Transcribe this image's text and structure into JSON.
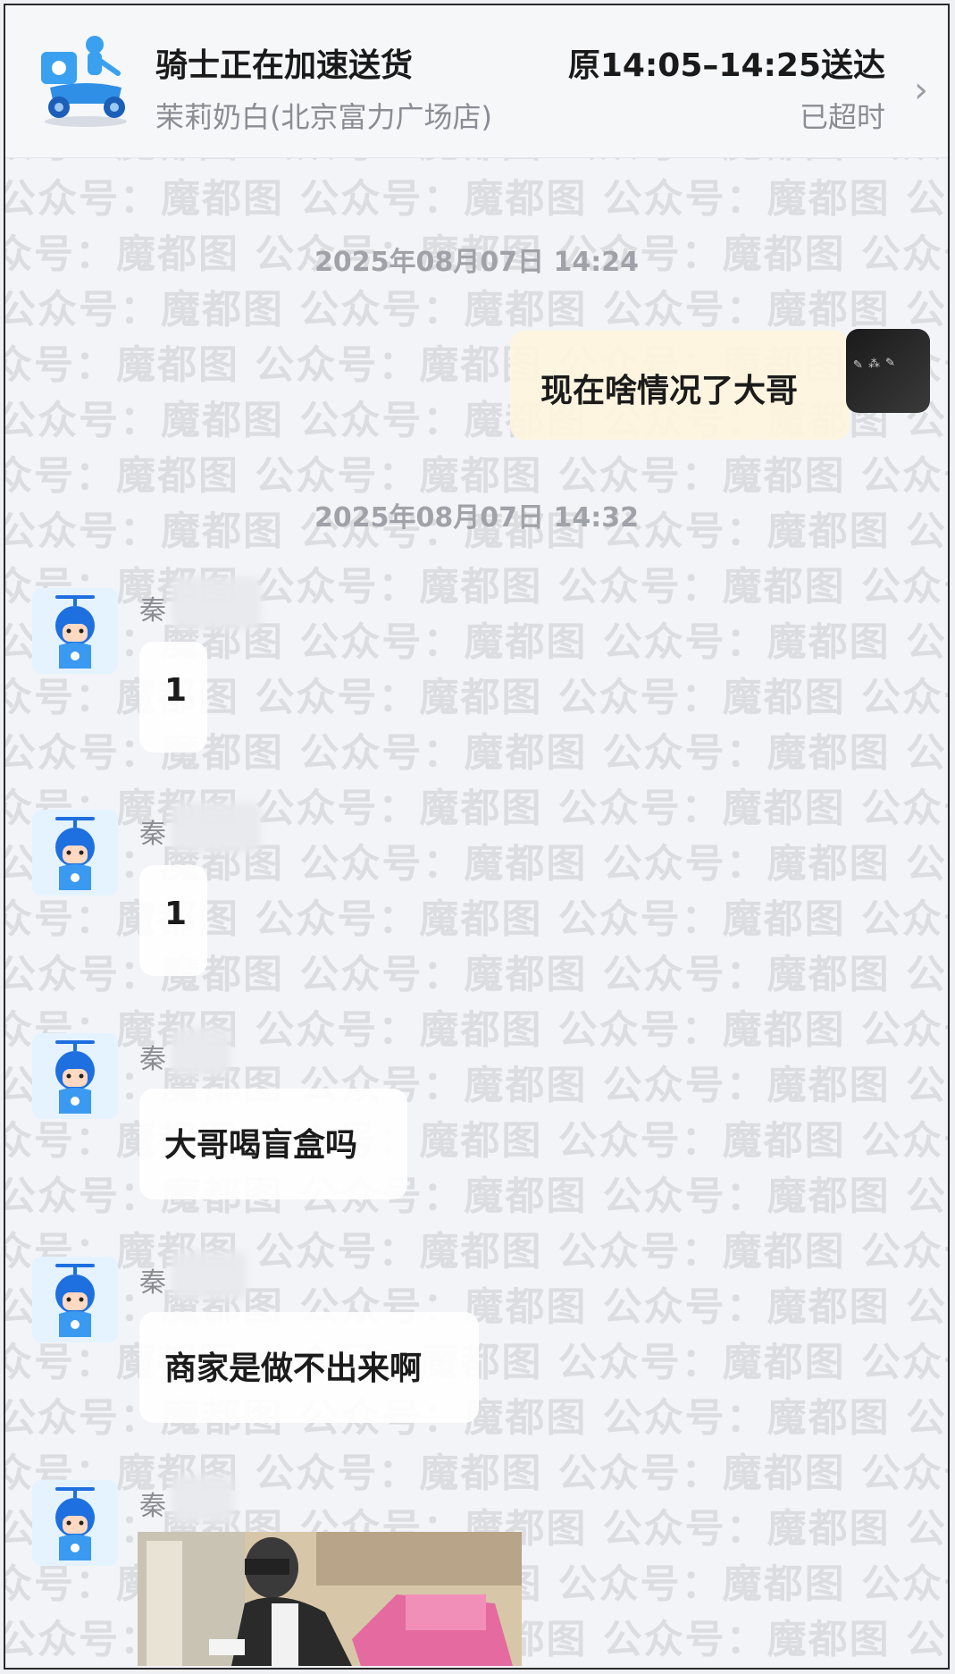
{
  "header": {
    "status_title": "骑士正在加速送货",
    "store_name": "茉莉奶白(北京富力广场店)",
    "eta": "原14:05–14:25送达",
    "overtime": "已超时"
  },
  "watermark": {
    "text": "公众号：魔都图"
  },
  "messages": [
    {
      "type": "timestamp",
      "text": "2025年08月07日 14:24"
    },
    {
      "type": "me",
      "text": "现在啥情况了大哥"
    },
    {
      "type": "timestamp",
      "text": "2025年08月07日 14:32"
    },
    {
      "type": "other",
      "sender": "秦",
      "text": "1"
    },
    {
      "type": "other",
      "sender": "秦",
      "text": "1"
    },
    {
      "type": "other",
      "sender": "秦",
      "text": "大哥喝盲盒吗"
    },
    {
      "type": "other",
      "sender": "秦",
      "text": "商家是做不出来啊"
    },
    {
      "type": "other",
      "sender": "秦",
      "text": ""
    }
  ],
  "colors": {
    "background": "#f3f4f7",
    "my_bubble": "#fff5de",
    "other_bubble": "#ffffff",
    "mascot_blue": "#1e6fe0",
    "timestamp_gray": "#9fa2a8"
  }
}
